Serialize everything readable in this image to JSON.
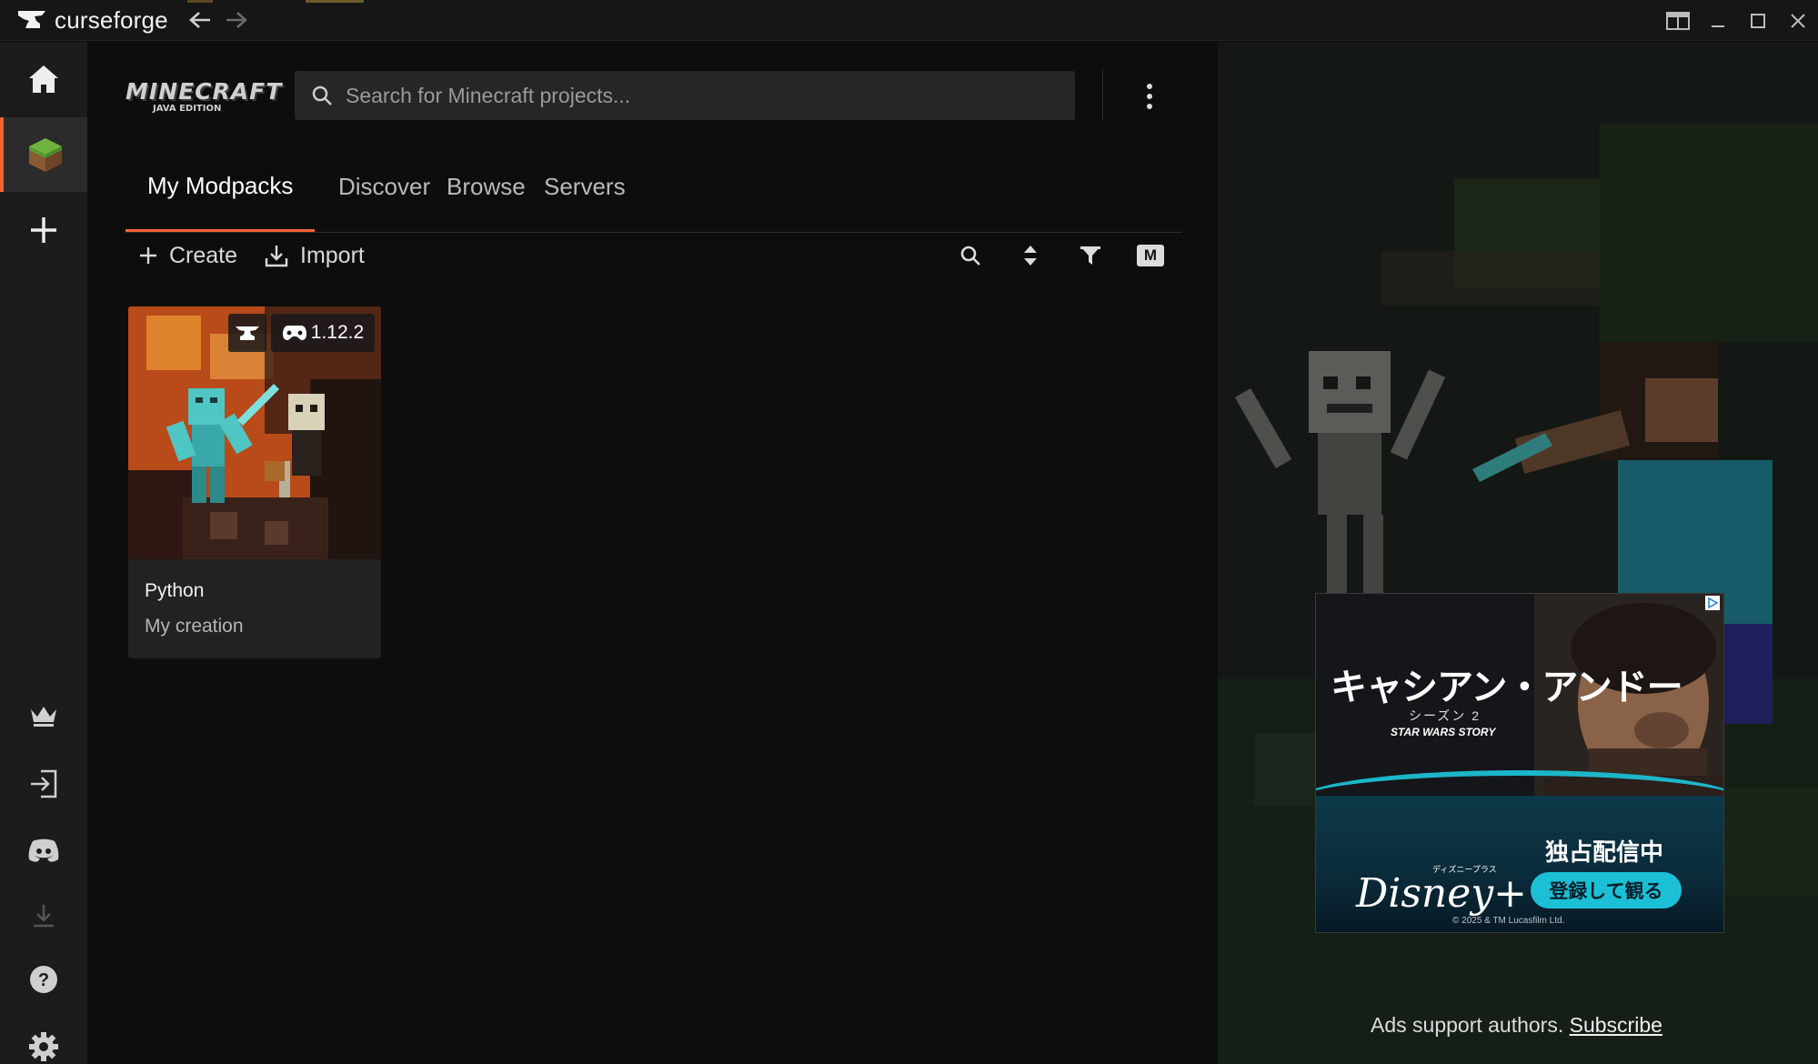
{
  "app": {
    "title": "curseforge",
    "colors": {
      "accent": "#f16436",
      "rail_bg": "#1c1c1c",
      "main_bg": "#0d0d0d"
    }
  },
  "titlebar": {
    "icons": [
      "curseforge-logo-icon",
      "back-arrow-icon",
      "forward-arrow-icon",
      "layout-icon",
      "minimize-icon",
      "maximize-icon",
      "close-icon"
    ]
  },
  "sidebar": {
    "items": [
      {
        "name": "home",
        "icon": "home-icon"
      },
      {
        "name": "minecraft",
        "icon": "minecraft-grass-block-icon",
        "active": true
      },
      {
        "name": "add-game",
        "icon": "plus-icon"
      },
      {
        "name": "premium",
        "icon": "crown-icon"
      },
      {
        "name": "login",
        "icon": "login-icon"
      },
      {
        "name": "discord",
        "icon": "discord-icon"
      },
      {
        "name": "downloads",
        "icon": "download-icon"
      },
      {
        "name": "help",
        "icon": "help-icon"
      },
      {
        "name": "settings",
        "icon": "gear-icon"
      }
    ]
  },
  "header": {
    "logo_line1": "MINECRAFT",
    "logo_line2": "JAVA EDITION",
    "search_placeholder": "Search for Minecraft projects..."
  },
  "tabs": [
    {
      "label": "My Modpacks",
      "active": true
    },
    {
      "label": "Discover"
    },
    {
      "label": "Browse"
    },
    {
      "label": "Servers"
    }
  ],
  "toolbar": {
    "create_label": "Create",
    "import_label": "Import",
    "view_mode": "M"
  },
  "modpacks": [
    {
      "title": "Python",
      "subtitle": "My creation",
      "version": "1.12.2"
    }
  ],
  "ad": {
    "title": "キャシアン・アンドー",
    "season": "シーズン 2",
    "brand_line": "STAR WARS STORY",
    "disney_small": "ディズニープラス",
    "disney": "Disney+",
    "streaming": "独占配信中",
    "cta": "登録して観る",
    "copyright": "© 2025 & TM Lucasfilm Ltd."
  },
  "ads_note": {
    "text": "Ads support authors.",
    "link": "Subscribe"
  }
}
